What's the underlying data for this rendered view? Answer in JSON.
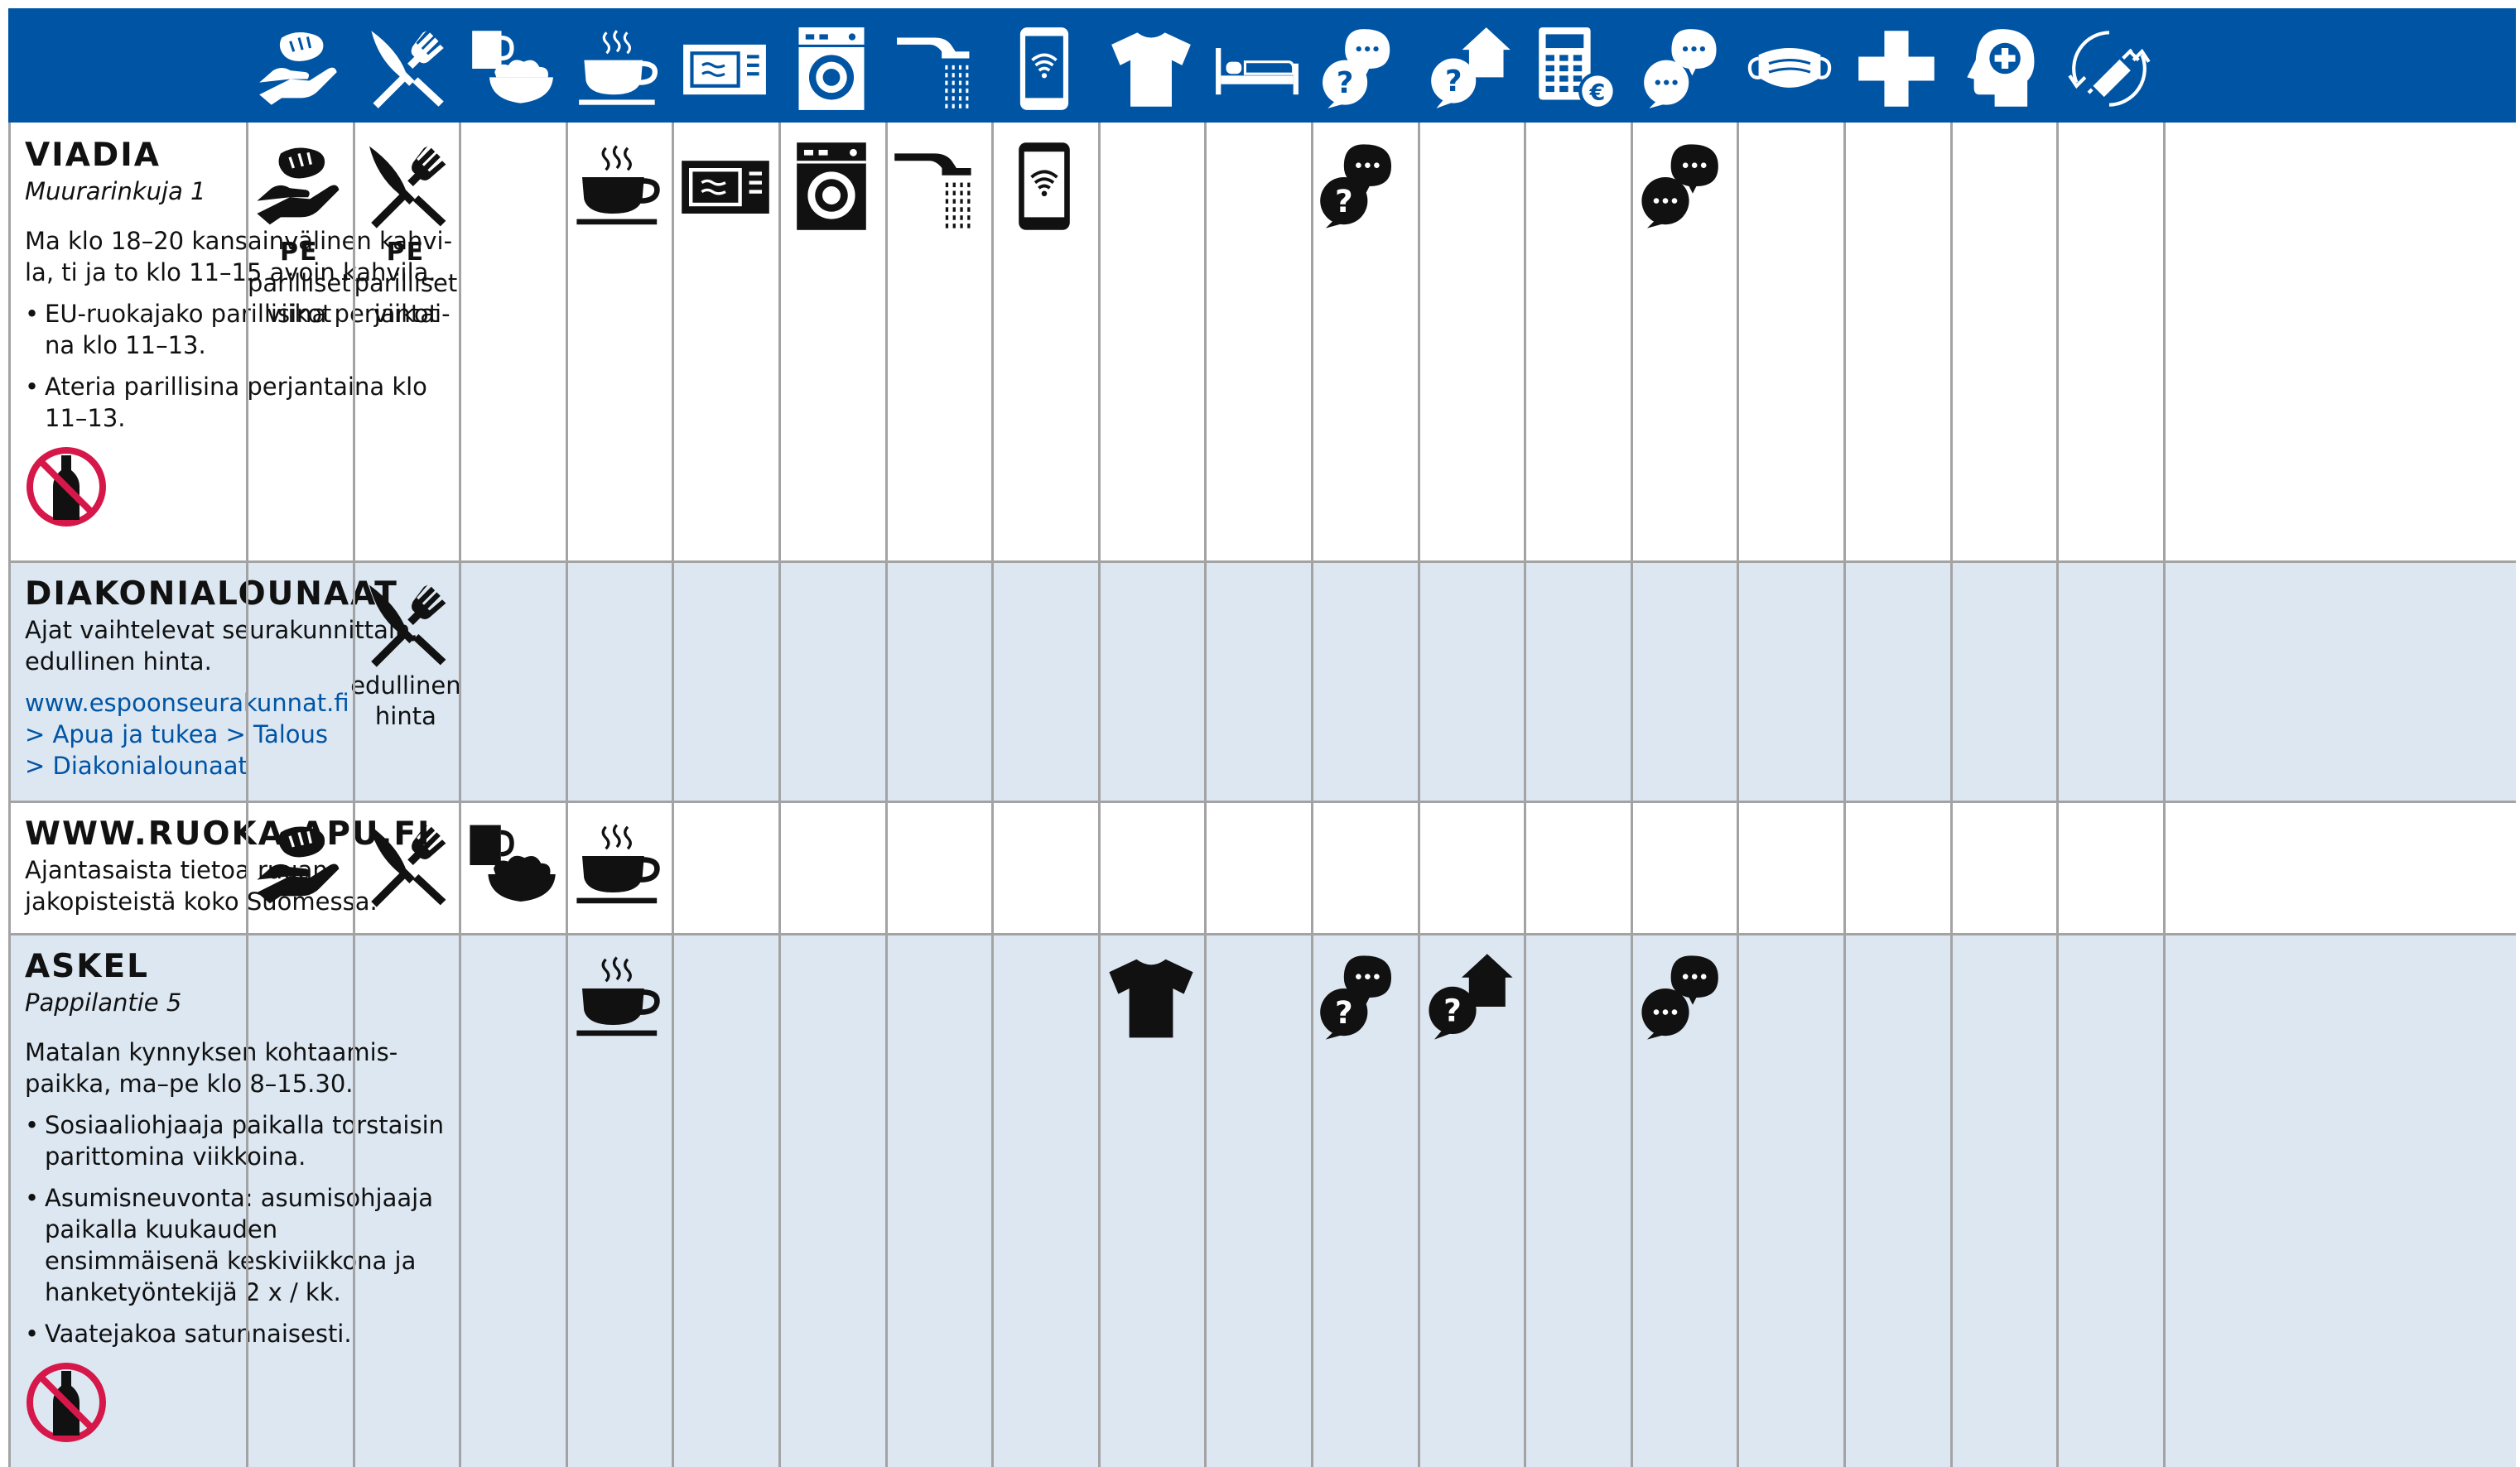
{
  "columns": [
    {
      "key": "food-bag",
      "icon": "hand-bread-icon"
    },
    {
      "key": "meal",
      "icon": "cutlery-icon"
    },
    {
      "key": "takeaway",
      "icon": "mug-bowl-icon"
    },
    {
      "key": "coffee",
      "icon": "coffee-cup-icon"
    },
    {
      "key": "microwave",
      "icon": "microwave-icon"
    },
    {
      "key": "laundry",
      "icon": "washing-machine-icon"
    },
    {
      "key": "shower",
      "icon": "shower-icon"
    },
    {
      "key": "wifi",
      "icon": "phone-wifi-icon"
    },
    {
      "key": "clothes",
      "icon": "tshirt-icon"
    },
    {
      "key": "bed",
      "icon": "bed-icon"
    },
    {
      "key": "counseling",
      "icon": "chat-question-icon"
    },
    {
      "key": "housing",
      "icon": "house-question-icon"
    },
    {
      "key": "finance",
      "icon": "calculator-euro-icon"
    },
    {
      "key": "discussion",
      "icon": "chat-bubbles-icon"
    },
    {
      "key": "mask",
      "icon": "face-mask-icon"
    },
    {
      "key": "health",
      "icon": "medical-cross-icon"
    },
    {
      "key": "mental",
      "icon": "head-cross-icon"
    },
    {
      "key": "vaccine",
      "icon": "syringe-icon"
    }
  ],
  "rows": [
    {
      "title": "VIADIA",
      "address": "Muurarinkuja 1",
      "text": "Ma klo 18–20 kansainvälinen kahvi­la, ti ja to klo 11–15 avoin kahvila.",
      "bullets": [
        "EU-ruokajako parillisina perjantai­na klo 11–13.",
        "Ateria parillisina perjantaina klo 11–13."
      ],
      "no_alcohol": true,
      "cells": {
        "0": {
          "bold": "PE",
          "caption": "parilliset viikot"
        },
        "1": {
          "bold": "PE",
          "caption": "parilliset viikot"
        },
        "3": {},
        "4": {},
        "5": {},
        "6": {},
        "7": {},
        "10": {},
        "13": {}
      }
    },
    {
      "title": "DIAKONIALOUNAAT",
      "text": "Ajat vaihtelevat seurakunnittain, edullinen hinta.",
      "links": [
        "www.espoonseurakunnat.fi",
        "> Apua ja tukea > Talous",
        "> Diakonialounaat"
      ],
      "cells": {
        "1": {
          "caption": "edullinen hinta"
        }
      }
    },
    {
      "title": "WWW.RUOKA-APU.FI",
      "text": "Ajantasaista tietoa ruuan­jakopisteistä koko Suomessa.",
      "cells": {
        "0": {},
        "1": {},
        "2": {},
        "3": {}
      }
    },
    {
      "title": "ASKEL",
      "address": "Pappilantie 5",
      "text": "Matalan kynnyksen kohtaamis­paikka, ma–pe klo 8–15.30.",
      "bullets": [
        "Sosiaaliohjaaja paikalla torstaisin parittomina viikkoina.",
        "Asumisneuvonta: asumisohjaaja paikalla kuukauden ensimmäisenä keskiviikkona ja hanketyöntekijä 2 x / kk.",
        "Vaatejakoa satunnaisesti."
      ],
      "no_alcohol": true,
      "cells": {
        "3": {},
        "8": {},
        "10": {},
        "11": {},
        "13": {}
      }
    }
  ],
  "colors": {
    "header": "#0054a4",
    "shade": "#dce7f2",
    "grid": "#a3a3a3",
    "link": "#0054a4",
    "no_alcohol": "#d6174a"
  }
}
